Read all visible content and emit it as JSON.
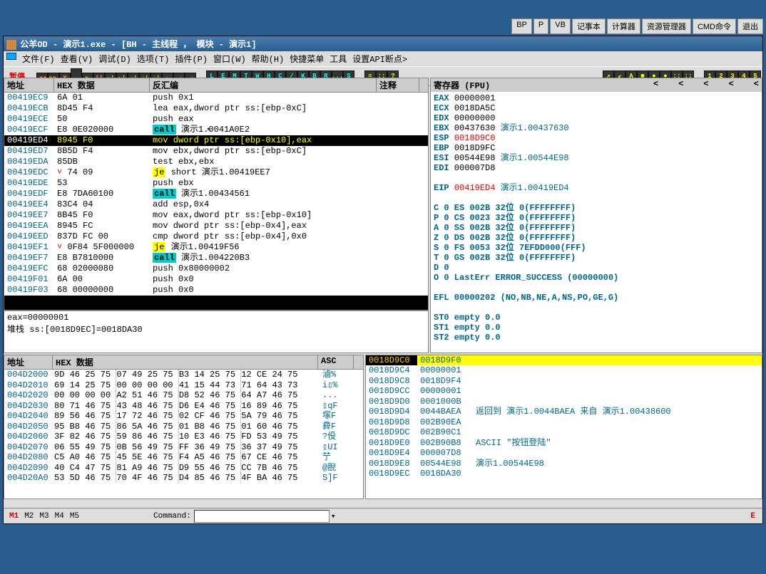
{
  "topbuttons": [
    "BP",
    "P",
    "VB",
    "记事本",
    "计算器",
    "资源管理器",
    "CMD命令",
    "退出"
  ],
  "title": "公羊OD  - 演示1.exe - [BH - 主线程 ， 模块 - 演示1]",
  "menu": [
    "文件(F)",
    "查看(V)",
    "调试(D)",
    "选项(T)",
    "插件(P)",
    "窗口(W)",
    "帮助(H)",
    "快捷菜单",
    "工具",
    "设置API断点>"
  ],
  "pause": "暂停",
  "tbtns1": [
    "◀◀",
    "▶▶",
    "X",
    "",
    "▶",
    "||",
    "▸|",
    "▸|",
    "↓|",
    "↓|",
    "↓|",
    "↘",
    "↵",
    "↵"
  ],
  "tbtns2": [
    "L",
    "E",
    "M",
    "T",
    "W",
    "H",
    "C",
    "/",
    "K",
    "B",
    "R",
    "...",
    "S"
  ],
  "tbtns3": [
    "≡",
    "::",
    "?"
  ],
  "tbtns4": [
    "↗",
    "↙",
    "A",
    "■",
    "●",
    "●",
    "::",
    "::"
  ],
  "tbtns5": [
    "1",
    "2",
    "3",
    "4",
    "5"
  ],
  "disasm_hdr": {
    "c1": "地址",
    "c2": "HEX 数据",
    "c3": "反汇编",
    "c4": "注释"
  },
  "disasm": [
    {
      "a": "00419EC9",
      "h": "6A 01",
      "s": "push 0x1"
    },
    {
      "a": "00419ECB",
      "h": "8D45 F4",
      "s": "lea eax,dword ptr ss:[ebp-0xC]"
    },
    {
      "a": "00419ECE",
      "h": "50",
      "s": "push eax"
    },
    {
      "a": "00419ECF",
      "h": "E8 0E020000",
      "s": "call 演示1.0041A0E2",
      "call": 1,
      "cursor": 1
    },
    {
      "a": "00419ED4",
      "h": "8945 F0",
      "s": "mov dword ptr ss:[ebp-0x10],eax",
      "sel": 1
    },
    {
      "a": "00419ED7",
      "h": "8B5D F4",
      "s": "mov ebx,dword ptr ss:[ebp-0xC]"
    },
    {
      "a": "00419EDA",
      "h": "85DB",
      "s": "test ebx,ebx"
    },
    {
      "a": "00419EDC",
      "h": "74 09",
      "s": "je short 演示1.00419EE7",
      "je": 1,
      "arrow": "˅"
    },
    {
      "a": "00419EDE",
      "h": "53",
      "s": "push ebx"
    },
    {
      "a": "00419EDF",
      "h": "E8 7DA60100",
      "s": "call 演示1.00434561",
      "call": 1
    },
    {
      "a": "00419EE4",
      "h": "83C4 04",
      "s": "add esp,0x4"
    },
    {
      "a": "00419EE7",
      "h": "8B45 F0",
      "s": "mov eax,dword ptr ss:[ebp-0x10]"
    },
    {
      "a": "00419EEA",
      "h": "8945 FC",
      "s": "mov dword ptr ss:[ebp-0x4],eax"
    },
    {
      "a": "00419EED",
      "h": "837D FC 00",
      "s": "cmp dword ptr ss:[ebp-0x4],0x0"
    },
    {
      "a": "00419EF1",
      "h": "0F84 5F000000",
      "s": "je 演示1.00419F56",
      "je": 1,
      "arrow": "˅"
    },
    {
      "a": "00419EF7",
      "h": "E8 B7810000",
      "s": "call 演示1.004220B3",
      "call": 1
    },
    {
      "a": "00419EFC",
      "h": "68 02000080",
      "s": "push 0x80000002"
    },
    {
      "a": "00419F01",
      "h": "6A 00",
      "s": "push 0x0"
    },
    {
      "a": "00419F03",
      "h": "68 00000000",
      "s": "push 0x0"
    }
  ],
  "info": [
    "eax=00000001",
    "堆栈 ss:[0018D9EC]=0018DA30"
  ],
  "regs_hdr": "寄存器 (FPU)",
  "regs": [
    {
      "n": "EAX",
      "v": "00000001"
    },
    {
      "n": "ECX",
      "v": "0018DA5C"
    },
    {
      "n": "EDX",
      "v": "00000000"
    },
    {
      "n": "EBX",
      "v": "00437630",
      "c": "演示1.00437630"
    },
    {
      "n": "ESP",
      "v": "0018D9C0",
      "red": 1
    },
    {
      "n": "EBP",
      "v": "0018D9FC"
    },
    {
      "n": "ESI",
      "v": "00544E98",
      "c": "演示1.00544E98"
    },
    {
      "n": "EDI",
      "v": "000007D8"
    }
  ],
  "eip": {
    "n": "EIP",
    "v": "00419ED4",
    "c": "演示1.00419ED4"
  },
  "flags": [
    "C 0  ES 002B 32位 0(FFFFFFFF)",
    "P 0  CS 0023 32位 0(FFFFFFFF)",
    "A 0  SS 002B 32位 0(FFFFFFFF)",
    "Z 0  DS 002B 32位 0(FFFFFFFF)",
    "S 0  FS 0053 32位 7EFDD000(FFF)",
    "T 0  GS 002B 32位 0(FFFFFFFF)",
    "D 0",
    "O 0  LastErr ERROR_SUCCESS (00000000)"
  ],
  "efl": "EFL 00000202 (NO,NB,NE,A,NS,PO,GE,G)",
  "fpu": [
    "ST0 empty 0.0",
    "ST1 empty 0.0",
    "ST2 empty 0.0"
  ],
  "hex_hdr": {
    "a": "地址",
    "h": "HEX 数据",
    "s": "ASC"
  },
  "hexdump": [
    {
      "a": "004D2000",
      "h": "9D 46 25 75|07 49 25 75|B3 14 25 75|12 CE 24 75",
      "s": "滷%"
    },
    {
      "a": "004D2010",
      "h": "69 14 25 75|00 00 00 00|41 15 44 73|71 64 43 73",
      "s": "i▯%"
    },
    {
      "a": "004D2020",
      "h": "00 00 00 00|A2 51 46 75|D8 52 46 75|64 A7 46 75",
      "s": "..."
    },
    {
      "a": "004D2030",
      "h": "80 71 46 75|43 48 46 75|D6 E4 46 75|16 89 46 75",
      "s": "▯qF"
    },
    {
      "a": "004D2040",
      "h": "89 56 46 75|17 72 46 75|02 CF 46 75|5A 79 46 75",
      "s": "塚F"
    },
    {
      "a": "004D2050",
      "h": "95 B8 46 75|86 5A 46 75|01 B8 46 75|01 60 46 75",
      "s": "彛F"
    },
    {
      "a": "004D2060",
      "h": "3F 82 46 75|59 86 46 75|10 E3 46 75|FD 53 49 75",
      "s": "?伇"
    },
    {
      "a": "004D2070",
      "h": "06 55 49 75|0B 56 49 75|FF 36 49 75|36 37 49 75",
      "s": "▯UI"
    },
    {
      "a": "004D2080",
      "h": "C5 A0 46 75|45 5E 46 75|F4 A5 46 75|67 CE 46 75",
      "s": "艼"
    },
    {
      "a": "004D2090",
      "h": "40 C4 47 75|81 A9 46 75|D9 55 46 75|CC 7B 46 75",
      "s": "@腉"
    },
    {
      "a": "004D20A0",
      "h": "53 5D 46 75|70 4F 46 75|D4 85 46 75|4F BA 46 75",
      "s": "S]F"
    }
  ],
  "stack_hdr": {
    "a": "0018D9C0",
    "v": "0018D9F0"
  },
  "stack": [
    {
      "a": "0018D9C4",
      "v": "00000001"
    },
    {
      "a": "0018D9C8",
      "v": "0018D9F4"
    },
    {
      "a": "0018D9CC",
      "v": "00000001"
    },
    {
      "a": "0018D9D0",
      "v": "0001000B"
    },
    {
      "a": "0018D9D4",
      "v": "0044BAEA",
      "c": "返回到 演示1.0044BAEA 来自 演示1.00438600"
    },
    {
      "a": "0018D9D8",
      "v": "002B90EA"
    },
    {
      "a": "0018D9DC",
      "v": "002B90C1"
    },
    {
      "a": "0018D9E0",
      "v": "002B90B8",
      "c": "ASCII \"按钮登陆\""
    },
    {
      "a": "0018D9E4",
      "v": "000007D8"
    },
    {
      "a": "0018D9E8",
      "v": "00544E98",
      "c": "演示1.00544E98"
    },
    {
      "a": "0018D9EC",
      "v": "0018DA30"
    }
  ],
  "mbtns": [
    "M1",
    "M2",
    "M3",
    "M4",
    "M5"
  ],
  "cmdlabel": "Command:",
  "stat_r": "E"
}
